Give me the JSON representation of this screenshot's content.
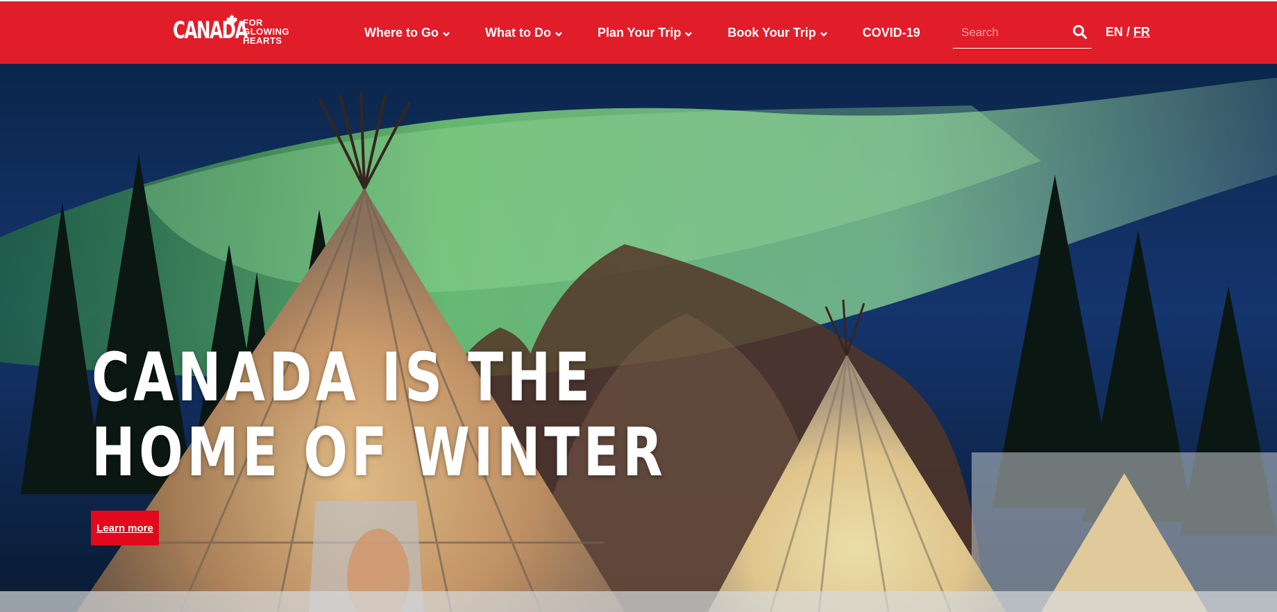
{
  "header": {
    "logo": {
      "wordmark": "CANADA",
      "tagline": [
        "FOR",
        "GLOWING",
        "HEARTS"
      ]
    },
    "nav": [
      {
        "label": "Where to Go",
        "has_dropdown": true
      },
      {
        "label": "What to Do",
        "has_dropdown": true
      },
      {
        "label": "Plan Your Trip",
        "has_dropdown": true
      },
      {
        "label": "Book Your Trip",
        "has_dropdown": true
      },
      {
        "label": "COVID-19",
        "has_dropdown": false
      }
    ],
    "search": {
      "placeholder": "Search",
      "value": "",
      "icon": "search-icon"
    },
    "language": {
      "current": "EN",
      "separator": "/",
      "alternate": "FR"
    }
  },
  "hero": {
    "headline_line1": "CANADA IS THE",
    "headline_line2": "HOME OF WINTER",
    "cta_label": "Learn more"
  },
  "colors": {
    "brand_red": "#e11d2a",
    "cta_red": "#e1091b",
    "aurora_green": "#8fe88f",
    "night_sky": "#173a78"
  }
}
